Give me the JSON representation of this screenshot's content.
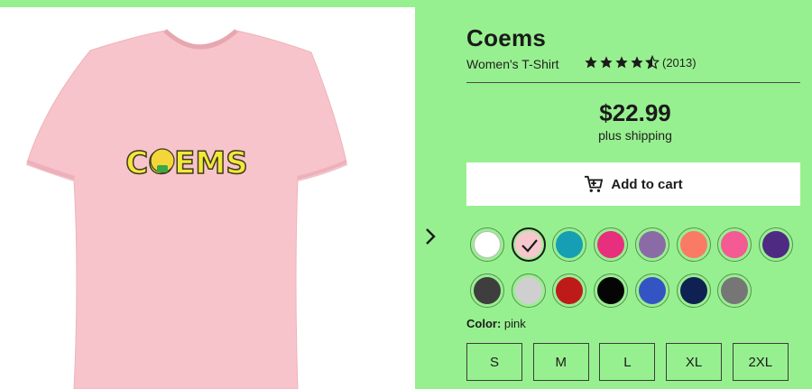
{
  "product": {
    "title": "Coems",
    "subtitle": "Women's T-Shirt",
    "rating_stars": 4.5,
    "rating_count": "(2013)",
    "price": "$22.99",
    "shipping": "plus shipping",
    "design_text": "COEMS"
  },
  "cart": {
    "label": "Add to cart"
  },
  "colors": {
    "label": "Color:",
    "selected": "pink",
    "swatches": [
      {
        "name": "white",
        "hex": "#ffffff"
      },
      {
        "name": "pink",
        "hex": "#f6c7cd",
        "selected": true
      },
      {
        "name": "teal",
        "hex": "#169eb4"
      },
      {
        "name": "raspberry",
        "hex": "#e72f7d"
      },
      {
        "name": "purple",
        "hex": "#8b6ba6"
      },
      {
        "name": "coral",
        "hex": "#fb7a66"
      },
      {
        "name": "hot pink",
        "hex": "#f45a93"
      },
      {
        "name": "dark purple",
        "hex": "#4f2a82"
      },
      {
        "name": "charcoal",
        "hex": "#3e3e3e"
      },
      {
        "name": "light gray",
        "hex": "#cfcfcf"
      },
      {
        "name": "red",
        "hex": "#bf1a1a"
      },
      {
        "name": "black",
        "hex": "#050505"
      },
      {
        "name": "royal blue",
        "hex": "#3554c4"
      },
      {
        "name": "navy",
        "hex": "#0f2153"
      },
      {
        "name": "gray",
        "hex": "#767676"
      }
    ]
  },
  "sizes": [
    "S",
    "M",
    "L",
    "XL",
    "2XL"
  ],
  "icons": {
    "next": "chevron-right-icon",
    "cart": "cart-icon",
    "check": "check-icon",
    "star": "star-icon"
  },
  "theme": {
    "background": "#97f08f",
    "shirt": "#f8c4cb"
  }
}
